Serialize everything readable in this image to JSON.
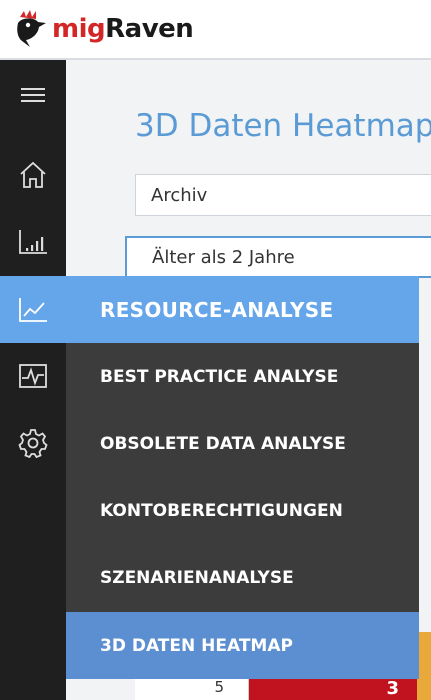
{
  "brand": {
    "part1": "mig",
    "part2": "Raven"
  },
  "sidebar": {
    "icons": [
      "menu-icon",
      "home-icon",
      "bar-chart-icon",
      "trend-line-icon",
      "activity-icon",
      "gear-icon"
    ]
  },
  "page": {
    "title": "3D Daten Heatmap",
    "select_1": "Archiv",
    "select_2": "Älter als 2 Jahre"
  },
  "menu": {
    "header": "RESOURCE-ANALYSE",
    "items": [
      {
        "label": "BEST PRACTICE ANALYSE",
        "active": false
      },
      {
        "label": "OBSOLETE DATA ANALYSE",
        "active": false
      },
      {
        "label": "KONTOBERECHTIGUNGEN",
        "active": false
      },
      {
        "label": "SZENARIENANALYSE",
        "active": false
      },
      {
        "label": "3D DATEN HEATMAP",
        "active": true
      }
    ]
  },
  "heatmap": {
    "row_label": "5",
    "cell_value": "3"
  },
  "colors": {
    "accent": "#65a5ea",
    "active_item": "#5b8fd1",
    "sidebar": "#1f1f1f",
    "submenu": "#3c3c3c",
    "heat_red": "#c1121f",
    "heat_orange": "#e8a93a"
  }
}
